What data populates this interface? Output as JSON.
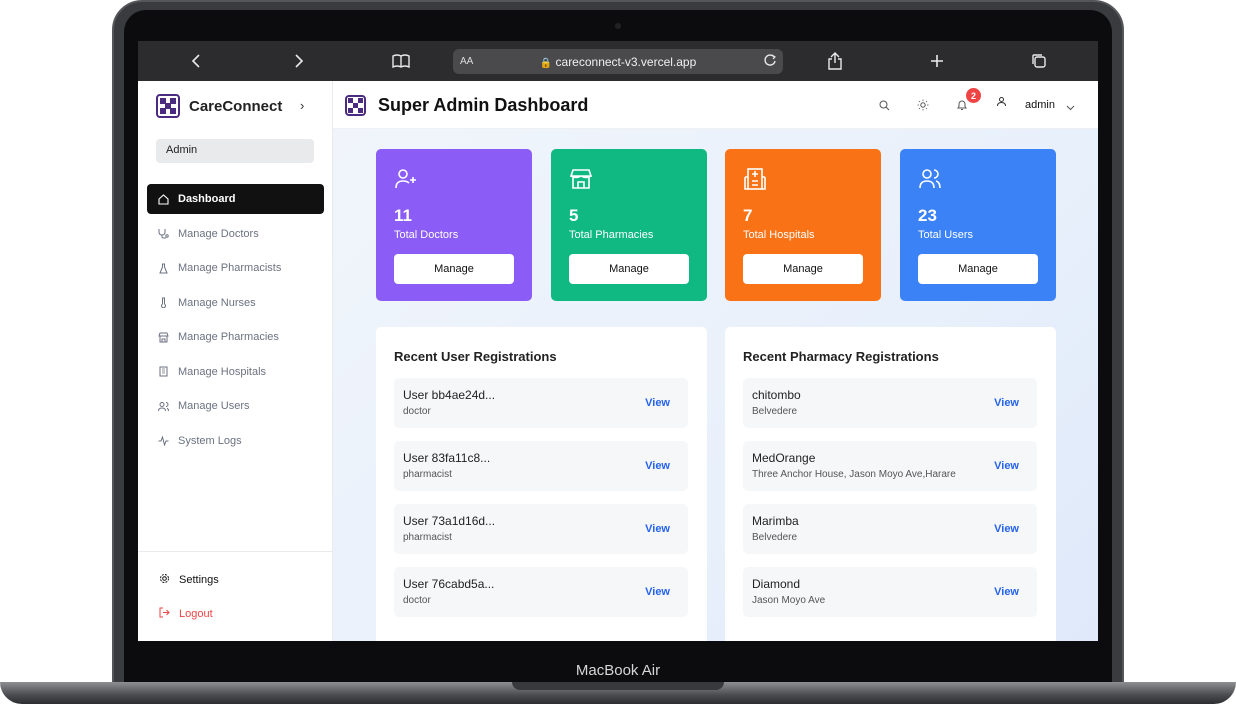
{
  "device": {
    "label": "MacBook Air"
  },
  "browser": {
    "aa": "AA",
    "url": "careconnect-v3.vercel.app"
  },
  "sidebar": {
    "brand": "CareConnect",
    "role": "Admin",
    "items": [
      {
        "label": "Dashboard",
        "icon": "home-icon",
        "active": true
      },
      {
        "label": "Manage Doctors",
        "icon": "stethoscope-icon"
      },
      {
        "label": "Manage Pharmacists",
        "icon": "flask-icon"
      },
      {
        "label": "Manage Nurses",
        "icon": "thermometer-icon"
      },
      {
        "label": "Manage Pharmacies",
        "icon": "store-icon"
      },
      {
        "label": "Manage Hospitals",
        "icon": "building-icon"
      },
      {
        "label": "Manage Users",
        "icon": "users-icon"
      },
      {
        "label": "System Logs",
        "icon": "activity-icon"
      }
    ],
    "settings": "Settings",
    "logout": "Logout"
  },
  "header": {
    "title": "Super Admin Dashboard",
    "notifications": "2",
    "user": "admin"
  },
  "stats": [
    {
      "value": "11",
      "label": "Total Doctors",
      "button": "Manage",
      "color": "#8b5cf6",
      "icon": "user-plus-icon"
    },
    {
      "value": "5",
      "label": "Total Pharmacies",
      "button": "Manage",
      "color": "#10b981",
      "icon": "store-icon"
    },
    {
      "value": "7",
      "label": "Total Hospitals",
      "button": "Manage",
      "color": "#f97316",
      "icon": "hospital-icon"
    },
    {
      "value": "23",
      "label": "Total Users",
      "button": "Manage",
      "color": "#3b82f6",
      "icon": "users-icon"
    }
  ],
  "recent_users": {
    "title": "Recent User Registrations",
    "rows": [
      {
        "name": "User bb4ae24d...",
        "sub": "doctor",
        "action": "View"
      },
      {
        "name": "User 83fa11c8...",
        "sub": "pharmacist",
        "action": "View"
      },
      {
        "name": "User 73a1d16d...",
        "sub": "pharmacist",
        "action": "View"
      },
      {
        "name": "User 76cabd5a...",
        "sub": "doctor",
        "action": "View"
      }
    ]
  },
  "recent_pharmacies": {
    "title": "Recent Pharmacy Registrations",
    "rows": [
      {
        "name": "chitombo",
        "sub": "Belvedere",
        "action": "View"
      },
      {
        "name": "MedOrange",
        "sub": "Three Anchor House, Jason Moyo Ave,Harare",
        "action": "View"
      },
      {
        "name": "Marimba",
        "sub": "Belvedere",
        "action": "View"
      },
      {
        "name": "Diamond",
        "sub": "Jason Moyo Ave",
        "action": "View"
      }
    ]
  }
}
